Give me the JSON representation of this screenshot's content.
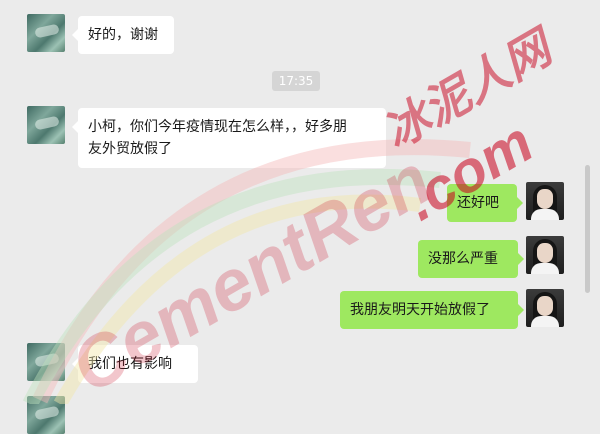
{
  "messages": [
    {
      "side": "left",
      "text": "好的，谢谢"
    },
    {
      "side": "left",
      "text_line1": "小柯，你们今年疫情现在怎么样，，好多朋",
      "text_line2": "友外贸放假了"
    },
    {
      "side": "right",
      "text": "还好吧"
    },
    {
      "side": "right",
      "text": "没那么严重"
    },
    {
      "side": "right",
      "text": "我朋友明天开始放假了"
    },
    {
      "side": "left",
      "text": "我们也有影响"
    }
  ],
  "timestamp": "17:35",
  "watermark": {
    "cjk": "冰泥人网",
    "latin": "CementRen",
    "domain": ".com",
    "color": "#c9001c"
  },
  "colors": {
    "background": "#ebebeb",
    "bubble_left": "#ffffff",
    "bubble_right": "#9ee860"
  },
  "icons": {
    "friend_avatar": "friend-avatar-icon",
    "my_avatar": "my-avatar-icon"
  }
}
